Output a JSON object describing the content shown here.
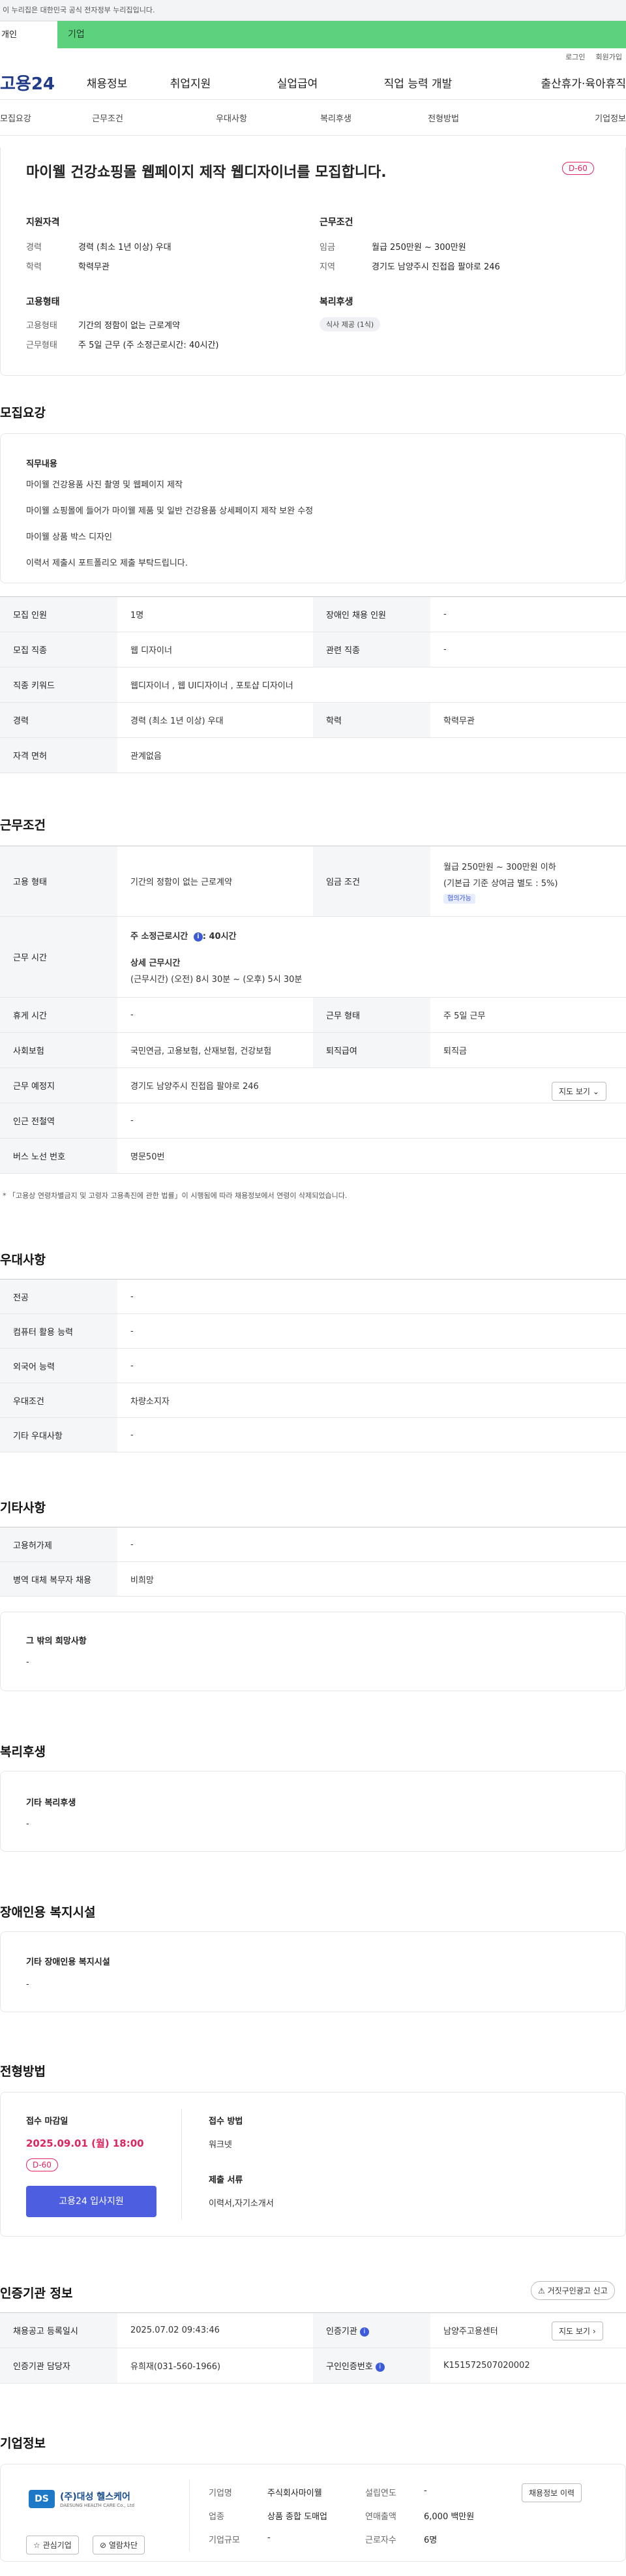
{
  "gov_banner": "이 누리집은 대한민국 공식 전자정부 누리집입니다.",
  "top_tabs": [
    "개인",
    "기업"
  ],
  "util_links": [
    "로그인",
    "회원가입"
  ],
  "logo": "고용24",
  "gnb": [
    "채용정보",
    "취업지원",
    "실업급여",
    "직업 능력 개발",
    "출산휴가·육아휴직"
  ],
  "subnav": [
    "모집요강",
    "근무조건",
    "우대사항",
    "복리후생",
    "전형방법",
    "기업정보"
  ],
  "headline": "마이웰 건강쇼핑몰 웹페이지 제작 웹디자이너를 모집합니다.",
  "dday": "D-60",
  "summary": {
    "qual_title": "지원자격",
    "career_k": "경력",
    "career_v": "경력 (최소 1년 이상) 우대",
    "edu_k": "학력",
    "edu_v": "학력무관",
    "emp_title": "고용형태",
    "emptype_k": "고용형태",
    "emptype_v": "기간의 정함이 없는 근로계약",
    "worktype_k": "근무형태",
    "worktype_v": "주 5일 근무 (주 소정근로시간: 40시간)",
    "cond_title": "근무조건",
    "wage_k": "임금",
    "wage_v": "월급 250만원 ~ 300만원",
    "region_k": "지역",
    "region_v": "경기도 남양주시 진접읍 팔야로 246",
    "welfare_title": "복리후생",
    "welfare_pill": "식사 제공 (1식)"
  },
  "recruit": {
    "title": "모집요강",
    "duty_title": "직무내용",
    "duty_lines": [
      "마이웰 건강용품 사진 촬영 및 웹페이지 제작",
      "마이웰 쇼핑몰에 들어가 마이웰 제품 및 일반 건강용품 상세페이지 제작 보완 수정",
      "마이웰 상품 박스 디자인",
      "이력서 제출시 포트폴리오 제출 부탁드립니다."
    ],
    "rows": {
      "num_k": "모집 인원",
      "num_v": "1명",
      "dis_k": "장애인 채용 인원",
      "dis_v": "-",
      "job_k": "모집 직종",
      "job_v": "웹 디자이너",
      "rel_k": "관련 직종",
      "rel_v": "-",
      "kw_k": "직종 키워드",
      "kw_v": "웹디자이너 , 웹 UI디자이너 , 포토샵 디자이너",
      "car_k": "경력",
      "car_v": "경력 (최소 1년 이상) 우대",
      "edu_k": "학력",
      "edu_v": "학력무관",
      "lic_k": "자격 면허",
      "lic_v": "관계없음"
    }
  },
  "conditions": {
    "title": "근무조건",
    "emp_k": "고용 형태",
    "emp_v": "기간의 정함이 없는 근로계약",
    "wage_k": "임금 조건",
    "wage_v1": "월급 250만원 ~ 300만원 이하",
    "wage_v2": "(기본급 기준 상여금 별도 : 5%)",
    "wage_badge": "협의가능",
    "time_k": "근무 시간",
    "time_v1": "주 소정근로시간 ",
    "time_v1b": ": 40시간",
    "time_v2": "상세 근무시간",
    "time_v3": "(근무시간) (오전) 8시 30분 ~ (오후) 5시 30분",
    "rest_k": "휴게 시간",
    "rest_v": "-",
    "form_k": "근무 형태",
    "form_v": "주 5일 근무",
    "ins_k": "사회보험",
    "ins_v": "국민연금, 고용보험, 산재보험, 건강보험",
    "ret_k": "퇴직급여",
    "ret_v": "퇴직금",
    "place_k": "근무 예정지",
    "place_v": "경기도 남양주시 진접읍 팔야로 246",
    "map_btn": "지도 보기",
    "sub_k": "인근 전철역",
    "sub_v": "-",
    "bus_k": "버스 노선 번호",
    "bus_v": "명문50번",
    "note": "* 「고용상 연령차별금지 및 고령자 고용촉진에 관한 법률」이 시행됨에 따라 채용정보에서 연령이 삭제되었습니다."
  },
  "pref": {
    "title": "우대사항",
    "major_k": "전공",
    "major_v": "-",
    "pc_k": "컴퓨터 활용 능력",
    "pc_v": "-",
    "lang_k": "외국어 능력",
    "lang_v": "-",
    "cond_k": "우대조건",
    "cond_v": "차량소지자",
    "etc_k": "기타 우대사항",
    "etc_v": "-"
  },
  "etc": {
    "title": "기타사항",
    "hire_k": "고용허가제",
    "hire_v": "-",
    "mil_k": "병역 대체 복무자 채용",
    "mil_v": "비희망",
    "other_title": "그 밖의 희망사항",
    "other_v": "-"
  },
  "welfare": {
    "title": "복리후생",
    "sub": "기타 복리후생",
    "v": "-"
  },
  "disabled": {
    "title": "장애인용 복지시설",
    "sub": "기타 장애인용 복지시설",
    "v": "-"
  },
  "process": {
    "title": "전형방법",
    "deadline_k": "접수 마감일",
    "deadline_v": "2025.09.01 (월) 18:00",
    "dday": "D-60",
    "apply_btn": "고용24 입사지원",
    "method_k": "접수 방법",
    "method_v": "워크넷",
    "docs_k": "제출 서류",
    "docs_v": "이력서,자기소개서"
  },
  "cert": {
    "title": "인증기관 정보",
    "report_btn": "거짓구인광고 신고",
    "reg_k": "채용공고 등록일시",
    "reg_v": "2025.07.02 09:43:46",
    "org_k": "인증기관",
    "org_v": "남양주고용센터",
    "map_btn": "지도 보기",
    "mgr_k": "인증기관 담당자",
    "mgr_v": "유희재(031-560-1966)",
    "no_k": "구인인증번호",
    "no_v": "K151572507020002"
  },
  "company": {
    "title": "기업정보",
    "name": "(주)대성 헬스케어",
    "logo_text": "DAESUNG HEALTH CARE Co., Ltd",
    "fav_btn": "관심기업",
    "block_btn": "열람차단",
    "rep_k": "기업명",
    "rep_v": "주식회사마이웰",
    "est_k": "설립연도",
    "est_v": "-",
    "ind_k": "업종",
    "ind_v": "상품 종합 도매업",
    "rev_k": "연매출액",
    "rev_v": "6,000 백만원",
    "size_k": "기업규모",
    "size_v": "-",
    "emp_k": "근로자수",
    "emp_v": "6명",
    "hist_btn": "채용정보 이력"
  }
}
